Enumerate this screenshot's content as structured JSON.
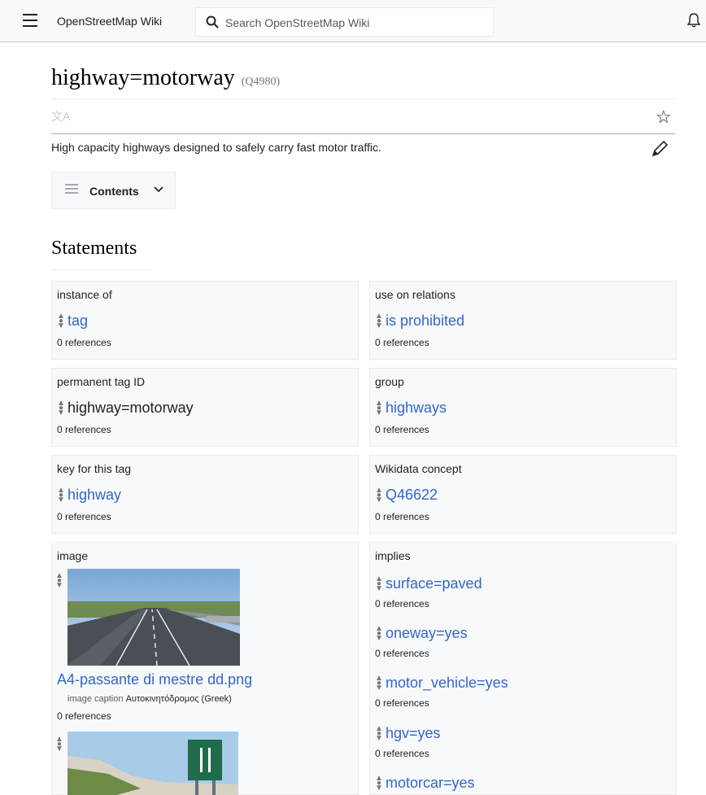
{
  "header": {
    "site_name": "OpenStreetMap Wiki",
    "search_placeholder": "Search OpenStreetMap Wiki"
  },
  "page": {
    "title": "highway=motorway",
    "qid": "(Q4980)",
    "description": "High capacity highways designed to safely carry fast motor traffic.",
    "toc_label": "Contents",
    "section_title": "Statements"
  },
  "statements": {
    "instance_of": {
      "property": "instance of",
      "value": "tag",
      "refs": "0 references"
    },
    "use_on_relations": {
      "property": "use on relations",
      "value": "is prohibited",
      "refs": "0 references"
    },
    "permanent_tag_id": {
      "property": "permanent tag ID",
      "value": "highway=motorway",
      "refs": "0 references"
    },
    "group": {
      "property": "group",
      "value": "highways",
      "refs": "0 references"
    },
    "key_for_tag": {
      "property": "key for this tag",
      "value": "highway",
      "refs": "0 references"
    },
    "wikidata_concept": {
      "property": "Wikidata concept",
      "value": "Q46622",
      "refs": "0 references"
    },
    "image": {
      "property": "image",
      "file": "A4-passante di mestre dd.png",
      "caption_label": "image caption",
      "caption_value": "Αυτοκινητόδρομος (Greek)",
      "refs": "0 references"
    },
    "implies": {
      "property": "implies",
      "items": [
        {
          "value": "surface=paved",
          "refs": "0 references"
        },
        {
          "value": "oneway=yes",
          "refs": "0 references"
        },
        {
          "value": "motor_vehicle=yes",
          "refs": "0 references"
        },
        {
          "value": "hgv=yes",
          "refs": "0 references"
        },
        {
          "value": "motorcar=yes",
          "refs": ""
        }
      ]
    }
  },
  "colors": {
    "link": "#3366cc",
    "card_bg": "#f8f9fa",
    "border": "#eaecf0"
  },
  "icons": [
    "menu-icon",
    "search-icon",
    "bell-icon",
    "translate-icon",
    "star-icon",
    "pencil-icon",
    "toc-icon",
    "chevron-down-icon",
    "rank-icon"
  ]
}
